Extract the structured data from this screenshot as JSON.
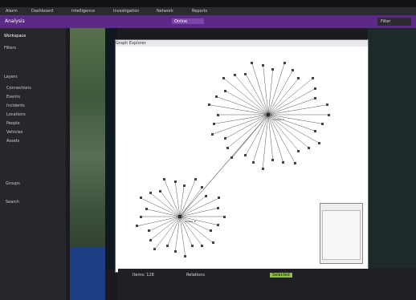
{
  "window": {
    "title": ""
  },
  "tabs": [
    {
      "label": "Alarm"
    },
    {
      "label": "Dashboard"
    },
    {
      "label": "Intelligence"
    },
    {
      "label": "Investigation"
    },
    {
      "label": "Network"
    },
    {
      "label": "Reports"
    }
  ],
  "toolbar": {
    "title": "Analysis",
    "status": "Online",
    "right_label": "Filter"
  },
  "sidebar": {
    "title": "Workspace",
    "section1": "Filters",
    "section2": "Layers",
    "items": [
      {
        "label": "Connections"
      },
      {
        "label": "Events"
      },
      {
        "label": "Incidents"
      },
      {
        "label": "Locations"
      },
      {
        "label": "People"
      },
      {
        "label": "Vehicles"
      },
      {
        "label": "Assets"
      }
    ],
    "groups": [
      {
        "label": "Groups"
      },
      {
        "label": "Search"
      }
    ]
  },
  "graph": {
    "title": "Graph Explorer",
    "clusterA_label": "Cluster A",
    "clusterB_label": "Cluster B"
  },
  "bottom": {
    "left": "Items: 128",
    "center": "Relations",
    "right": "Selected"
  },
  "colors": {
    "accent": "#5b2a86",
    "sidebar": "#26262b",
    "canvas": "#ffffff"
  }
}
